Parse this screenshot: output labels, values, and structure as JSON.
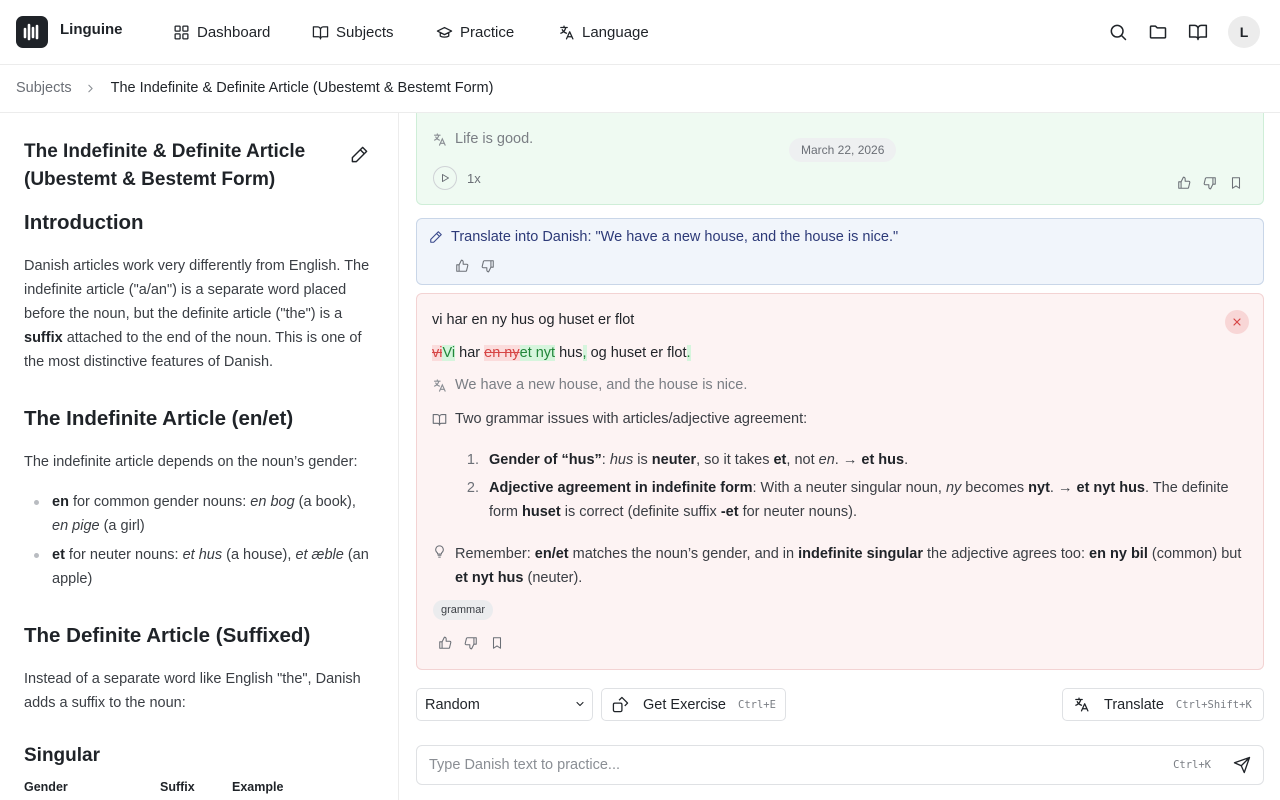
{
  "app": {
    "name": "Linguine"
  },
  "nav": {
    "dashboard": "Dashboard",
    "subjects": "Subjects",
    "practice": "Practice",
    "language": "Language"
  },
  "user": {
    "initial": "L"
  },
  "breadcrumb": {
    "parent": "Subjects",
    "current": "The Indefinite & Definite Article (Ubestemt & Bestemt Form)"
  },
  "lesson": {
    "title": "The Indefinite & Definite Article (Ubestemt & Bestemt Form)",
    "intro_heading": "Introduction",
    "intro_text_1": "Danish articles work very differently from English. The indefinite article (\"a/an\") is a separate word placed before the noun, but the definite article (\"the\") is a ",
    "intro_bold": "suffix",
    "intro_text_2": " attached to the end of the noun. This is one of the most distinctive features of Danish.",
    "indef_heading": "The Indefinite Article (en/et)",
    "indef_text": "The indefinite article depends on the noun’s gender:",
    "bullet1": {
      "bold": "en",
      "t1": " for common gender nouns: ",
      "i1": "en bog",
      "t2": " (a book), ",
      "i2": "en pige",
      "t3": " (a girl)"
    },
    "bullet2": {
      "bold": "et",
      "t1": " for neuter nouns: ",
      "i1": "et hus",
      "t2": " (a house), ",
      "i2": "et æble",
      "t3": " (an apple)"
    },
    "def_heading": "The Definite Article (Suffixed)",
    "def_text": "Instead of a separate word like English \"the\", Danish adds a suffix to the noun:",
    "singular_heading": "Singular",
    "table_headers": [
      "Gender",
      "Suffix",
      "Example"
    ]
  },
  "prev_card": {
    "translation": "Life is good.",
    "date": "March 22, 2026",
    "speed": "1x"
  },
  "prompt_card": {
    "text": "Translate into Danish: \"We have a new house, and the house is nice.\""
  },
  "answer_card": {
    "answer": "vi har en ny hus og huset er flot",
    "diff": {
      "del1": "vi",
      "ins1": "Vi",
      "t1": " har ",
      "del2": "en ny",
      "ins2": "et nyt",
      "t2": " hus",
      "ins3": ",",
      "t3": " og huset er flot",
      "ins4": "."
    },
    "translation": "We have a new house, and the house is nice.",
    "summary": "Two grammar issues with articles/adjective agreement:",
    "issue1": {
      "b1": "Gender of “hus”",
      "t1": ": ",
      "i1": "hus",
      "t2": " is ",
      "b2": "neuter",
      "t3": ", so it takes ",
      "b3": "et",
      "t4": ", not ",
      "i2": "en",
      "t5": ". → ",
      "b4": "et hus",
      "t6": "."
    },
    "issue2": {
      "b1": "Adjective agreement in indefinite form",
      "t1": ": With a neuter singular noun, ",
      "i1": "ny",
      "t2": " becomes ",
      "b2": "nyt",
      "t3": ". → ",
      "b3": "et nyt hus",
      "t4": ". The definite form ",
      "b4": "huset",
      "t5": " is correct (definite suffix ",
      "b5": "-et",
      "t6": " for neuter nouns)."
    },
    "remember": {
      "t1": "Remember: ",
      "b1": "en/et",
      "t2": " matches the noun’s gender, and in ",
      "b2": "indefinite singular",
      "t3": " the adjective agrees too: ",
      "b3": "en ny bil",
      "t4": " (common) but ",
      "b4": "et nyt hus",
      "t5": " (neuter)."
    },
    "tag": "grammar"
  },
  "controls": {
    "mode": "Random",
    "get_exercise": "Get Exercise",
    "get_exercise_shortcut": "Ctrl+E",
    "translate": "Translate",
    "translate_shortcut": "Ctrl+Shift+K",
    "input_placeholder": "Type Danish text to practice...",
    "input_shortcut": "Ctrl+K"
  },
  "colors": {
    "correct_bg": "#effaf2",
    "prompt_bg": "#f1f5fb",
    "error_bg": "#fdf3f3",
    "deleted": "#d64545",
    "inserted": "#22863a"
  }
}
